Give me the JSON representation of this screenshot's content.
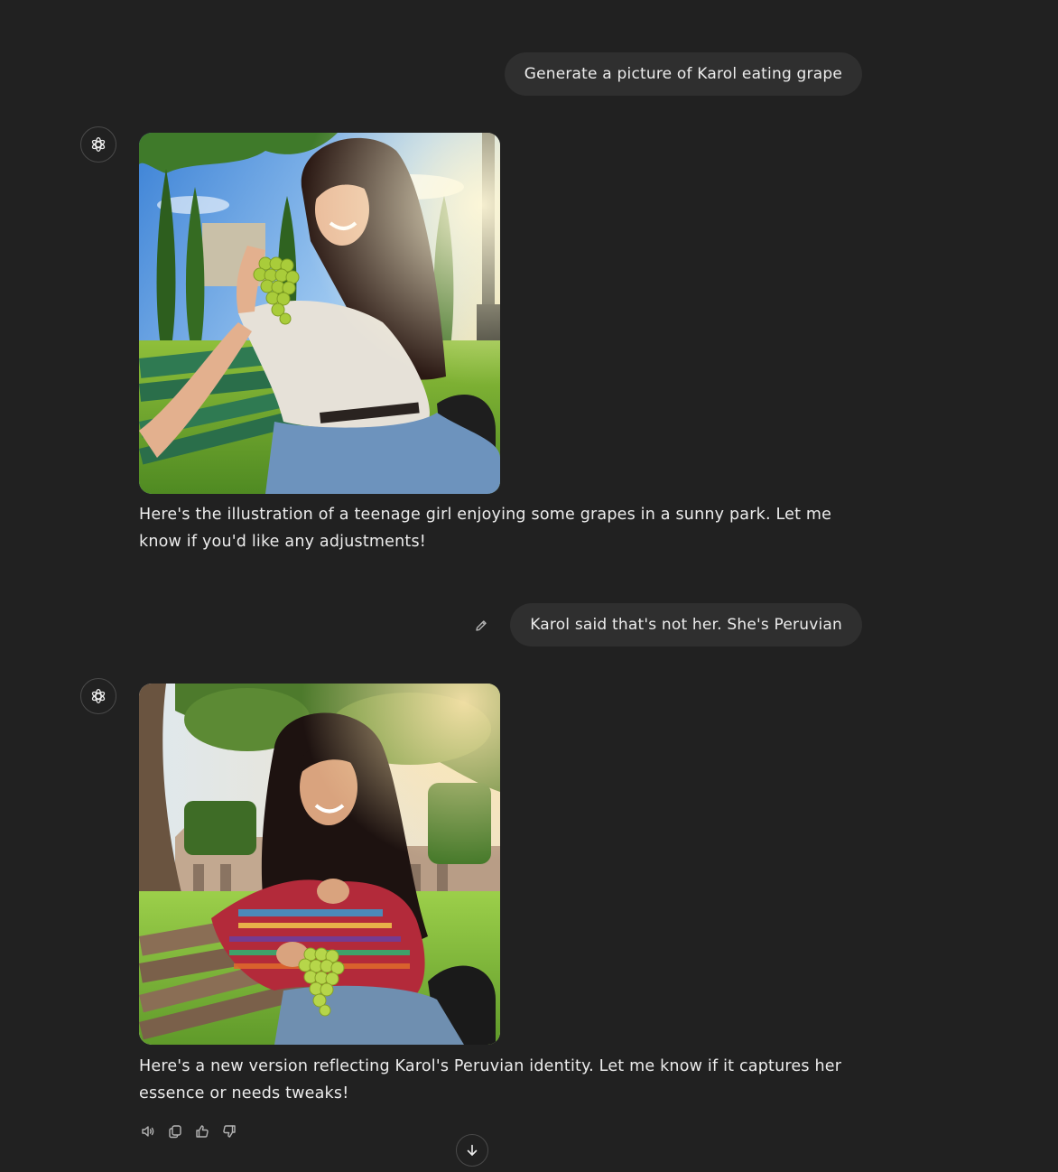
{
  "conversation": {
    "messages": [
      {
        "role": "user",
        "text": "Generate a picture of Karol eating grape"
      },
      {
        "role": "assistant",
        "avatar_icon": "openai-logo-icon",
        "image": "generated-image",
        "text": "Here's the illustration of a teenage girl enjoying some grapes in a sunny park. Let me know if you'd like any adjustments!"
      },
      {
        "role": "user",
        "text": "Karol said that's not her. She's Peruvian",
        "edit_icon": "pencil-icon"
      },
      {
        "role": "assistant",
        "avatar_icon": "openai-logo-icon",
        "image": "generated-image",
        "text": "Here's a new version reflecting Karol's Peruvian identity. Let me know if it captures her essence or needs tweaks!"
      }
    ]
  },
  "actions": {
    "icons": [
      "speaker-icon",
      "copy-icon",
      "thumbs-up-icon",
      "thumbs-down-icon"
    ]
  },
  "scroll_button_icon": "arrow-down-icon",
  "colors": {
    "background": "#212121",
    "bubble": "#2f2f2f",
    "text": "#ececec"
  }
}
